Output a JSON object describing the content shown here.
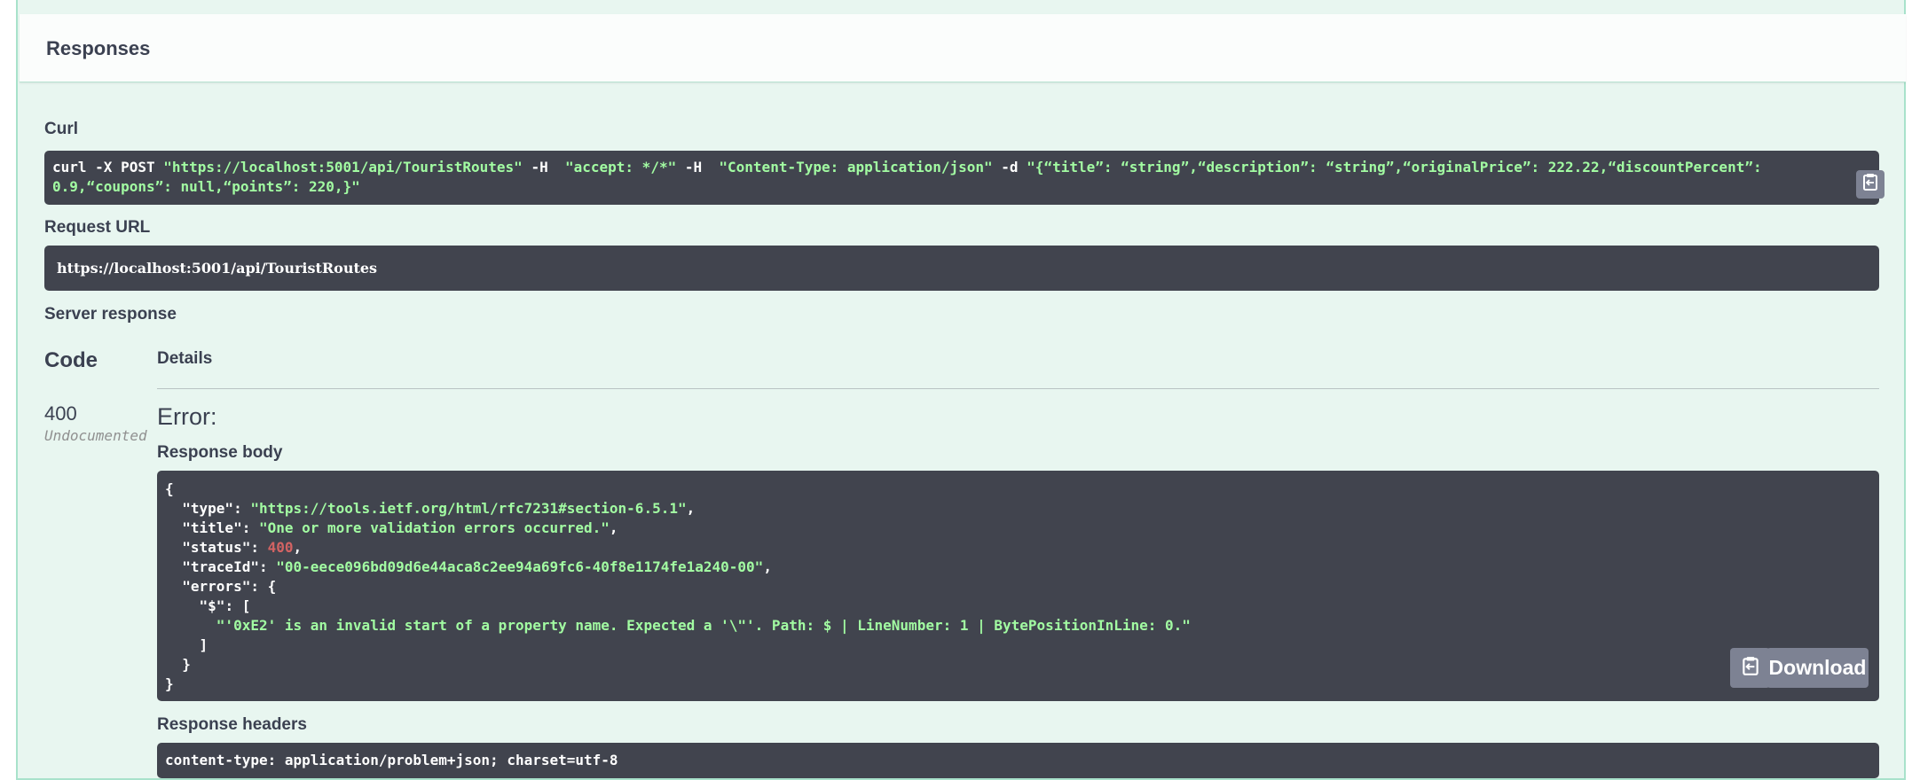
{
  "responses": {
    "title": "Responses"
  },
  "curl": {
    "label": "Curl",
    "line1_parts": [
      {
        "t": "curl -X POST ",
        "c": "plain"
      },
      {
        "t": "\"https://localhost:5001/api/TouristRoutes\"",
        "c": "str"
      },
      {
        "t": " -H  ",
        "c": "plain"
      },
      {
        "t": "\"accept: */*\"",
        "c": "str"
      },
      {
        "t": " -H  ",
        "c": "plain"
      },
      {
        "t": "\"Content-Type: application/json\"",
        "c": "str"
      },
      {
        "t": " -d ",
        "c": "plain"
      },
      {
        "t": "\"{“title”: “string”,“description”: “string”,“originalPrice”: 222.22,“discountPercent”:",
        "c": "str"
      }
    ],
    "line2": "0.9,“coupons”: null,“points”: 220,}\""
  },
  "request_url": {
    "label": "Request URL",
    "value": "https://localhost:5001/api/TouristRoutes"
  },
  "server_response": {
    "label": "Server response",
    "code_header": "Code",
    "details_header": "Details",
    "status_code": "400",
    "undocumented": "Undocumented",
    "error_title": "Error:",
    "response_body_label": "Response body",
    "body_lines": [
      [
        {
          "t": "{",
          "c": "plain"
        }
      ],
      [
        {
          "t": "  \"type\"",
          "c": "plain"
        },
        {
          "t": ": ",
          "c": "plain"
        },
        {
          "t": "\"https://tools.ietf.org/html/rfc7231#section-6.5.1\"",
          "c": "str"
        },
        {
          "t": ",",
          "c": "plain"
        }
      ],
      [
        {
          "t": "  \"title\"",
          "c": "plain"
        },
        {
          "t": ": ",
          "c": "plain"
        },
        {
          "t": "\"One or more validation errors occurred.\"",
          "c": "str"
        },
        {
          "t": ",",
          "c": "plain"
        }
      ],
      [
        {
          "t": "  \"status\"",
          "c": "plain"
        },
        {
          "t": ": ",
          "c": "plain"
        },
        {
          "t": "400",
          "c": "num"
        },
        {
          "t": ",",
          "c": "plain"
        }
      ],
      [
        {
          "t": "  \"traceId\"",
          "c": "plain"
        },
        {
          "t": ": ",
          "c": "plain"
        },
        {
          "t": "\"00-eece096bd09d6e44aca8c2ee94a69fc6-40f8e1174fe1a240-00\"",
          "c": "str"
        },
        {
          "t": ",",
          "c": "plain"
        }
      ],
      [
        {
          "t": "  \"errors\"",
          "c": "plain"
        },
        {
          "t": ": {",
          "c": "plain"
        }
      ],
      [
        {
          "t": "    \"$\"",
          "c": "plain"
        },
        {
          "t": ": [",
          "c": "plain"
        }
      ],
      [
        {
          "t": "      ",
          "c": "plain"
        },
        {
          "t": "\"'0xE2' is an invalid start of a property name. Expected a '\\\"'. Path: $ | LineNumber: 1 | BytePositionInLine: 0.\"",
          "c": "str"
        }
      ],
      [
        {
          "t": "    ]",
          "c": "plain"
        }
      ],
      [
        {
          "t": "  }",
          "c": "plain"
        }
      ],
      [
        {
          "t": "}",
          "c": "plain"
        }
      ]
    ],
    "download_label": "Download",
    "response_headers_label": "Response headers",
    "headers_preview": " content-type: application/problem+json; charset=utf-8 "
  },
  "icons": {
    "copy": "clipboard-copy-icon"
  },
  "colors": {
    "panel_bg": "#e8f6f0",
    "panel_border": "#a8e2cb",
    "code_bg": "#41444e",
    "string": "#a2fca2",
    "number": "#d36363"
  }
}
